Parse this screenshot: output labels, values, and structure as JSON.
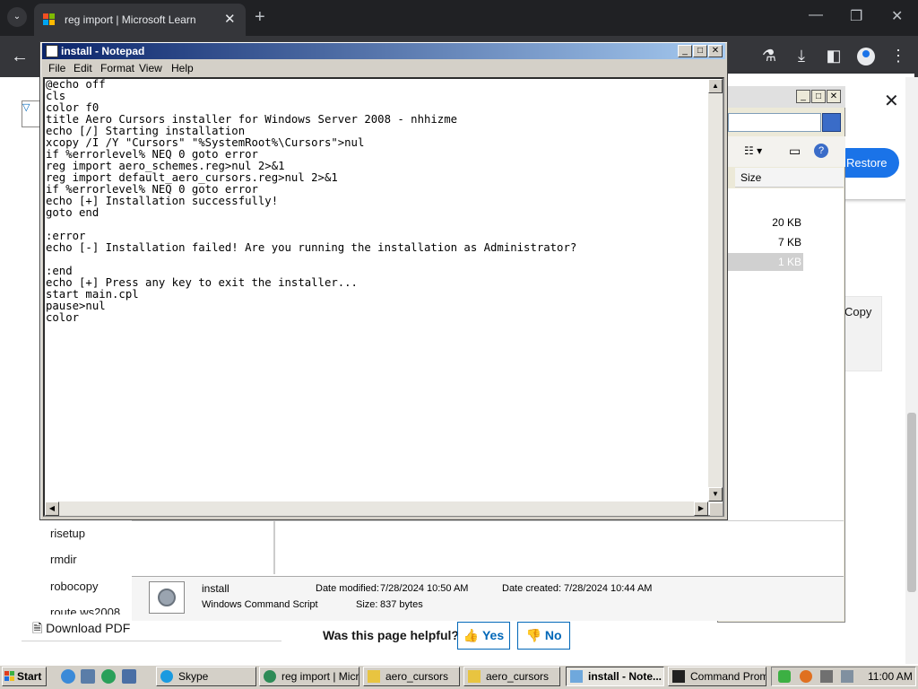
{
  "browser": {
    "tab_title": "reg import | Microsoft Learn",
    "tab_close": "✕",
    "new_tab": "+",
    "window_controls": [
      "—",
      "❐",
      "✕"
    ],
    "toolbar_icons": [
      "flask-icon",
      "download-icon",
      "side-panel-icon",
      "profile-icon",
      "menu-icon"
    ]
  },
  "page": {
    "restore_button": "Restore",
    "close_symbol": "✕",
    "copy_label": "Copy",
    "nav_items": [
      "risetup",
      "rmdir",
      "robocopy",
      "route ws2008"
    ],
    "download_pdf": "Download PDF",
    "helpful_question": "Was this page helpful?",
    "yes": "Yes",
    "no": "No"
  },
  "explorer": {
    "size_header": "Size",
    "file_sizes": [
      "20 KB",
      "7 KB",
      "1 KB"
    ],
    "details": {
      "name": "install",
      "type": "Windows Command Script",
      "modified_label": "Date modified:",
      "modified": "7/28/2024 10:50 AM",
      "created_label": "Date created:",
      "created": "7/28/2024 10:44 AM",
      "size_label": "Size:",
      "size": "837 bytes"
    }
  },
  "notepad": {
    "title": "install - Notepad",
    "menu": [
      "File",
      "Edit",
      "Format",
      "View",
      "Help"
    ],
    "content": "@echo off\ncls\ncolor f0\ntitle Aero Cursors installer for Windows Server 2008 - nhhizme\necho [/] Starting installation\nxcopy /I /Y \"Cursors\" \"%SystemRoot%\\Cursors\">nul\nif %errorlevel% NEQ 0 goto error\nreg import aero_schemes.reg>nul 2>&1\nreg import default_aero_cursors.reg>nul 2>&1\nif %errorlevel% NEQ 0 goto error\necho [+] Installation successfully!\ngoto end\n\n:error\necho [-] Installation failed! Are you running the installation as Administrator?\n\n:end\necho [+] Press any key to exit the installer...\nstart main.cpl\npause>nul\ncolor"
  },
  "taskbar": {
    "start": "Start",
    "tasks": [
      {
        "label": "Skype",
        "icon": "skype-icon",
        "color": "#1a9ae0"
      },
      {
        "label": "reg import | Micr...",
        "icon": "browser-icon",
        "color": "#2e8b57"
      },
      {
        "label": "aero_cursors",
        "icon": "folder-icon",
        "color": "#e8c440"
      },
      {
        "label": "aero_cursors",
        "icon": "folder-icon",
        "color": "#e8c440"
      },
      {
        "label": "install - Note...",
        "icon": "notepad-icon",
        "color": "#6fa8dc"
      },
      {
        "label": "Command Prompt",
        "icon": "cmd-icon",
        "color": "#202020"
      }
    ],
    "clock": "11:00 AM"
  }
}
